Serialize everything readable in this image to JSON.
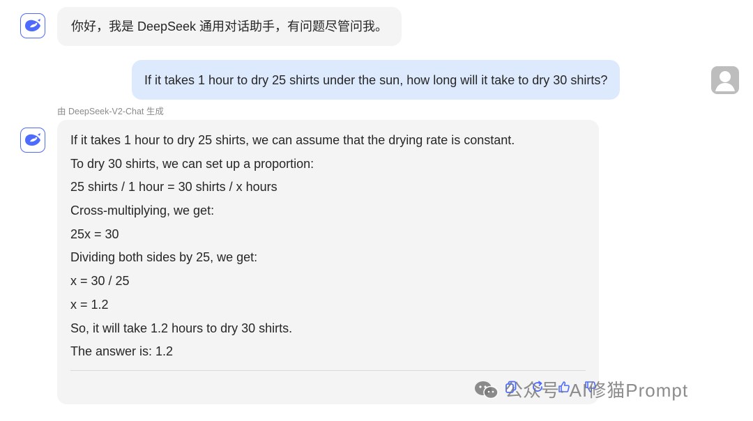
{
  "conversation": {
    "greeting": "你好，我是 DeepSeek 通用对话助手，有问题尽管问我。",
    "user_message": "If it takes 1 hour to dry 25 shirts under the sun, how long will it take to dry 30 shirts?",
    "model_label": "由 DeepSeek-V2-Chat 生成",
    "answer_lines": [
      "If it takes 1 hour to dry 25 shirts, we can assume that the drying rate is constant.",
      "To dry 30 shirts, we can set up a proportion:",
      "25 shirts / 1 hour = 30 shirts / x hours",
      "Cross-multiplying, we get:",
      "25x = 30",
      "Dividing both sides by 25, we get:",
      "x = 30 / 25",
      "x = 1.2",
      "So, it will take 1.2 hours to dry 30 shirts.",
      "The answer is: 1.2"
    ]
  },
  "icons": {
    "bot_avatar": "deepseek-whale-icon",
    "user_avatar": "user-avatar-icon",
    "actions": [
      "copy-icon",
      "regenerate-icon",
      "thumbs-up-icon",
      "thumbs-down-icon"
    ],
    "watermark": "wechat-icon"
  },
  "watermark": {
    "prefix": "公众号·",
    "brand": "AI修猫Prompt"
  },
  "colors": {
    "accent": "#4d6bfe",
    "user_bubble": "#dde9fc",
    "assistant_bubble": "#f4f4f4",
    "muted_text": "#8a8a8a"
  }
}
